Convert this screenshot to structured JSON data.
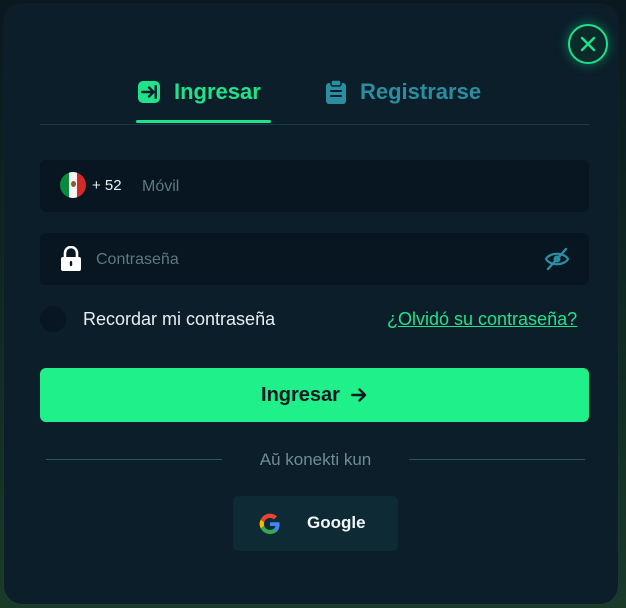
{
  "tabs": [
    {
      "label": "Ingresar",
      "icon": "login-arrow-icon",
      "active": true
    },
    {
      "label": "Registrarse",
      "icon": "clipboard-icon",
      "active": false
    }
  ],
  "phone": {
    "country_flag": "mexico-flag-icon",
    "prefix": "+ 52",
    "placeholder": "Móvil",
    "value": ""
  },
  "password": {
    "placeholder": "Contraseña",
    "value": ""
  },
  "remember": {
    "label": "Recordar mi contraseña",
    "checked": false
  },
  "forgot_link": "¿Olvidó su contraseña?",
  "submit": {
    "label": "Ingresar"
  },
  "divider_text": "Aŭ konekti kun",
  "social": {
    "google_label": "Google"
  },
  "colors": {
    "accent": "#1ff089",
    "modal_bg": "#0b1e2a",
    "field_bg": "#071620",
    "inactive_tab": "#2b8ea0"
  }
}
